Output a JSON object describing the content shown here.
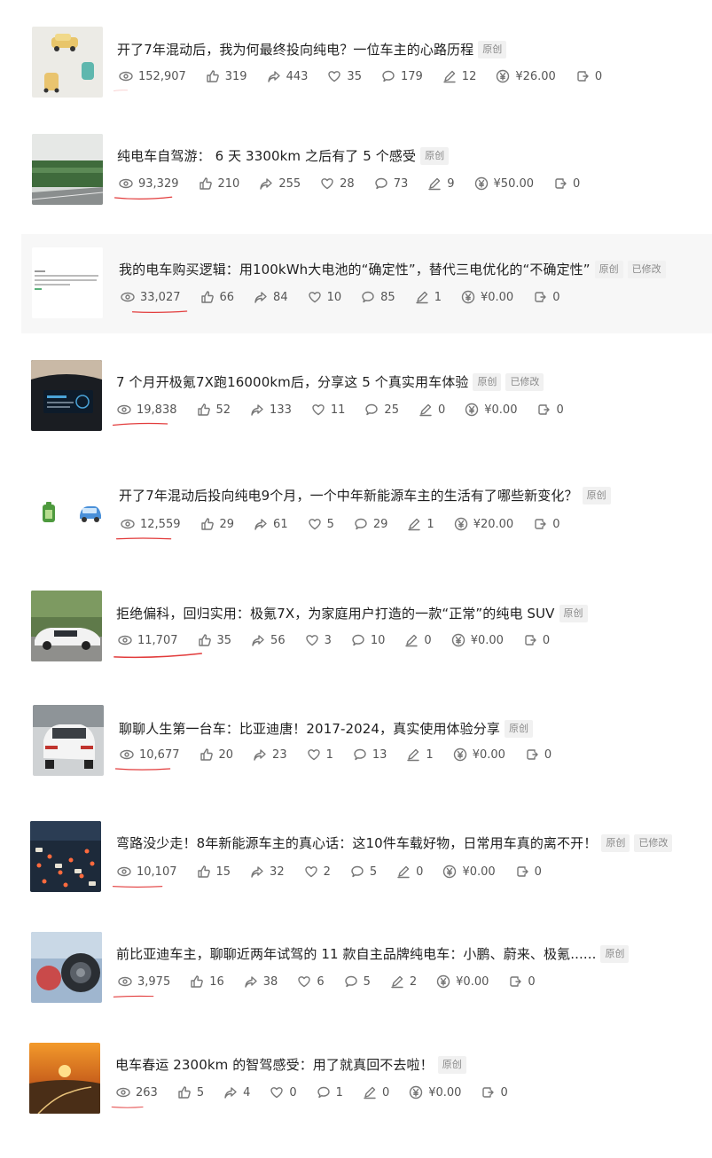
{
  "articles": [
    {
      "title": "开了7年混动后，我为何最终投向纯电？一位车主的心路历程",
      "tags": [
        "原创"
      ],
      "views": "152,907",
      "likes": "319",
      "shares": "443",
      "favorites": "35",
      "comments": "179",
      "edits": "12",
      "earnings": "¥26.00",
      "reposts": "0"
    },
    {
      "title": "纯电车自驾游： 6 天 3300km 之后有了 5 个感受",
      "tags": [
        "原创"
      ],
      "views": "93,329",
      "likes": "210",
      "shares": "255",
      "favorites": "28",
      "comments": "73",
      "edits": "9",
      "earnings": "¥50.00",
      "reposts": "0"
    },
    {
      "title": "我的电车购买逻辑：用100kWh大电池的“确定性”，替代三电优化的“不确定性”",
      "tags": [
        "原创",
        "已修改"
      ],
      "views": "33,027",
      "likes": "66",
      "shares": "84",
      "favorites": "10",
      "comments": "85",
      "edits": "1",
      "earnings": "¥0.00",
      "reposts": "0"
    },
    {
      "title": "7 个月开极氪7X跑16000km后，分享这 5 个真实用车体验",
      "tags": [
        "原创",
        "已修改"
      ],
      "views": "19,838",
      "likes": "52",
      "shares": "133",
      "favorites": "11",
      "comments": "25",
      "edits": "0",
      "earnings": "¥0.00",
      "reposts": "0"
    },
    {
      "title": "开了7年混动后投向纯电9个月，一个中年新能源车主的生活有了哪些新变化？",
      "tags": [
        "原创"
      ],
      "views": "12,559",
      "likes": "29",
      "shares": "61",
      "favorites": "5",
      "comments": "29",
      "edits": "1",
      "earnings": "¥20.00",
      "reposts": "0"
    },
    {
      "title": "拒绝偏科，回归实用：极氪7X，为家庭用户打造的一款“正常”的纯电 SUV",
      "tags": [
        "原创"
      ],
      "views": "11,707",
      "likes": "35",
      "shares": "56",
      "favorites": "3",
      "comments": "10",
      "edits": "0",
      "earnings": "¥0.00",
      "reposts": "0"
    },
    {
      "title": "聊聊人生第一台车：比亚迪唐！2017-2024，真实使用体验分享",
      "tags": [
        "原创"
      ],
      "views": "10,677",
      "likes": "20",
      "shares": "23",
      "favorites": "1",
      "comments": "13",
      "edits": "1",
      "earnings": "¥0.00",
      "reposts": "0"
    },
    {
      "title": "弯路没少走！8年新能源车主的真心话：这10件车载好物，日常用车真的离不开！",
      "tags": [
        "原创",
        "已修改"
      ],
      "views": "10,107",
      "likes": "15",
      "shares": "32",
      "favorites": "2",
      "comments": "5",
      "edits": "0",
      "earnings": "¥0.00",
      "reposts": "0"
    },
    {
      "title": "前比亚迪车主，聊聊近两年试驾的 11 款自主品牌纯电车：小鹏、蔚来、极氪......",
      "tags": [
        "原创"
      ],
      "views": "3,975",
      "likes": "16",
      "shares": "38",
      "favorites": "6",
      "comments": "5",
      "edits": "2",
      "earnings": "¥0.00",
      "reposts": "0"
    },
    {
      "title": "电车春运 2300km 的智驾感受：用了就真回不去啦！",
      "tags": [
        "原创"
      ],
      "views": "263",
      "likes": "5",
      "shares": "4",
      "favorites": "0",
      "comments": "1",
      "edits": "0",
      "earnings": "¥0.00",
      "reposts": "0"
    }
  ],
  "colors": {
    "underline": "#e23b3b",
    "icon": "#777777",
    "tag_bg": "#f1f1f1"
  },
  "icons": [
    "eye-icon",
    "thumbs-up-icon",
    "share-arrow-icon",
    "heart-icon",
    "comment-icon",
    "pen-icon",
    "yuan-coin-icon",
    "repost-icon"
  ]
}
